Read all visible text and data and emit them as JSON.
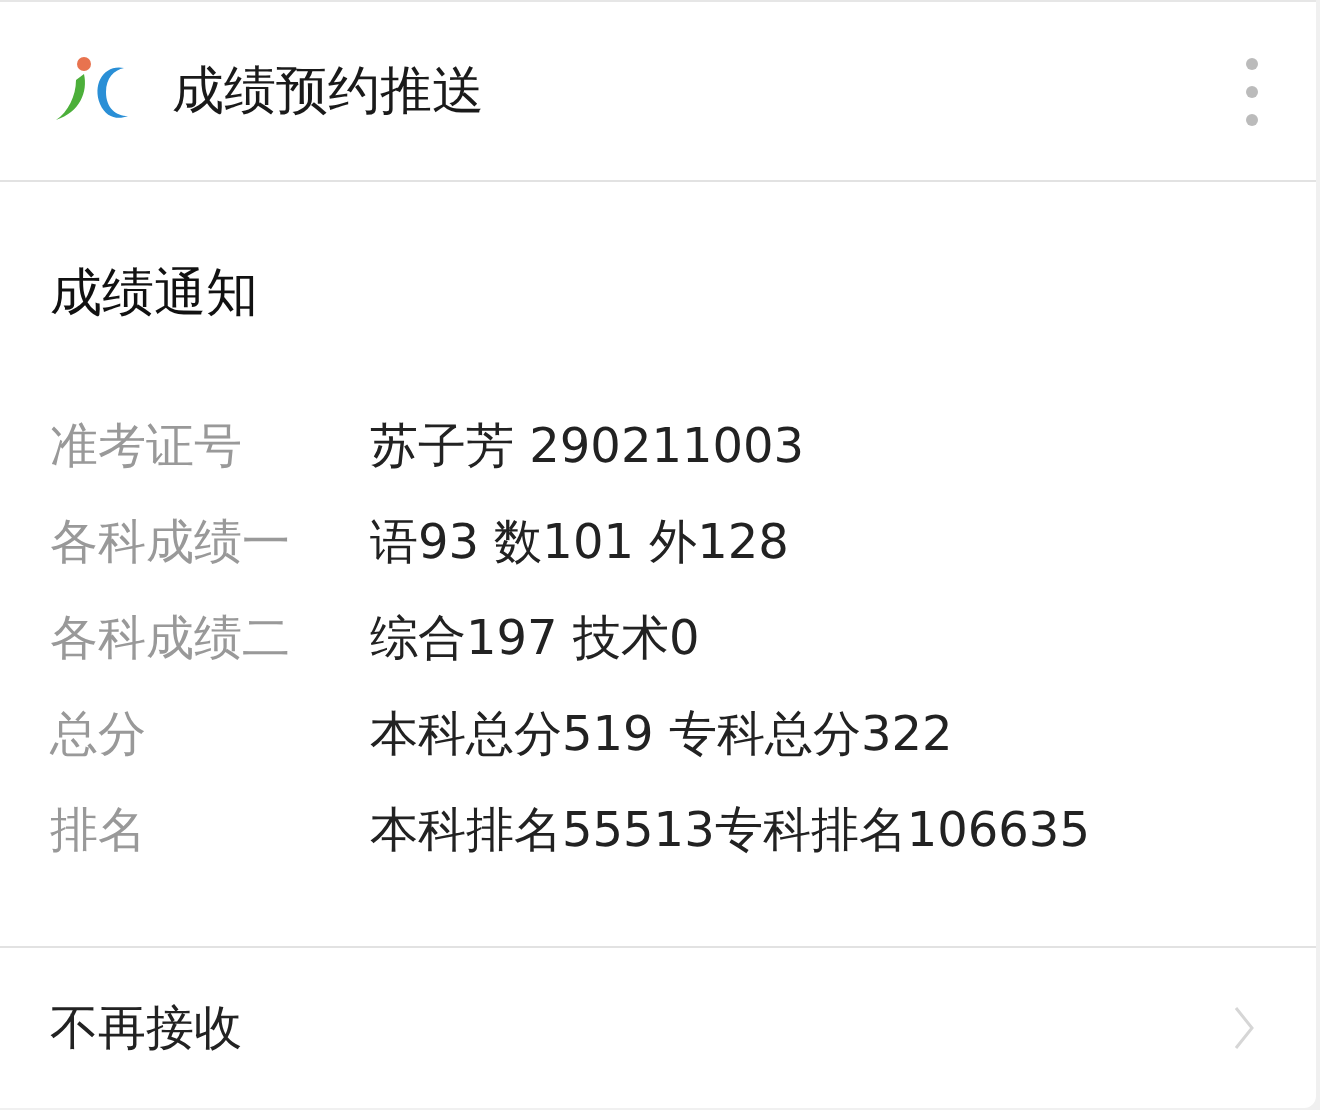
{
  "header": {
    "title": "成绩预约推送"
  },
  "notice": {
    "title": "成绩通知",
    "rows": [
      {
        "label": "准考证号",
        "value": "苏子芳 290211003"
      },
      {
        "label": "各科成绩一",
        "value": "语93 数101 外128"
      },
      {
        "label": "各科成绩二",
        "value": "综合197 技术0"
      },
      {
        "label": "总分",
        "value": "本科总分519 专科总分322"
      },
      {
        "label": "排名",
        "value": "本科排名55513专科排名106635"
      }
    ]
  },
  "footer": {
    "label": "不再接收"
  }
}
